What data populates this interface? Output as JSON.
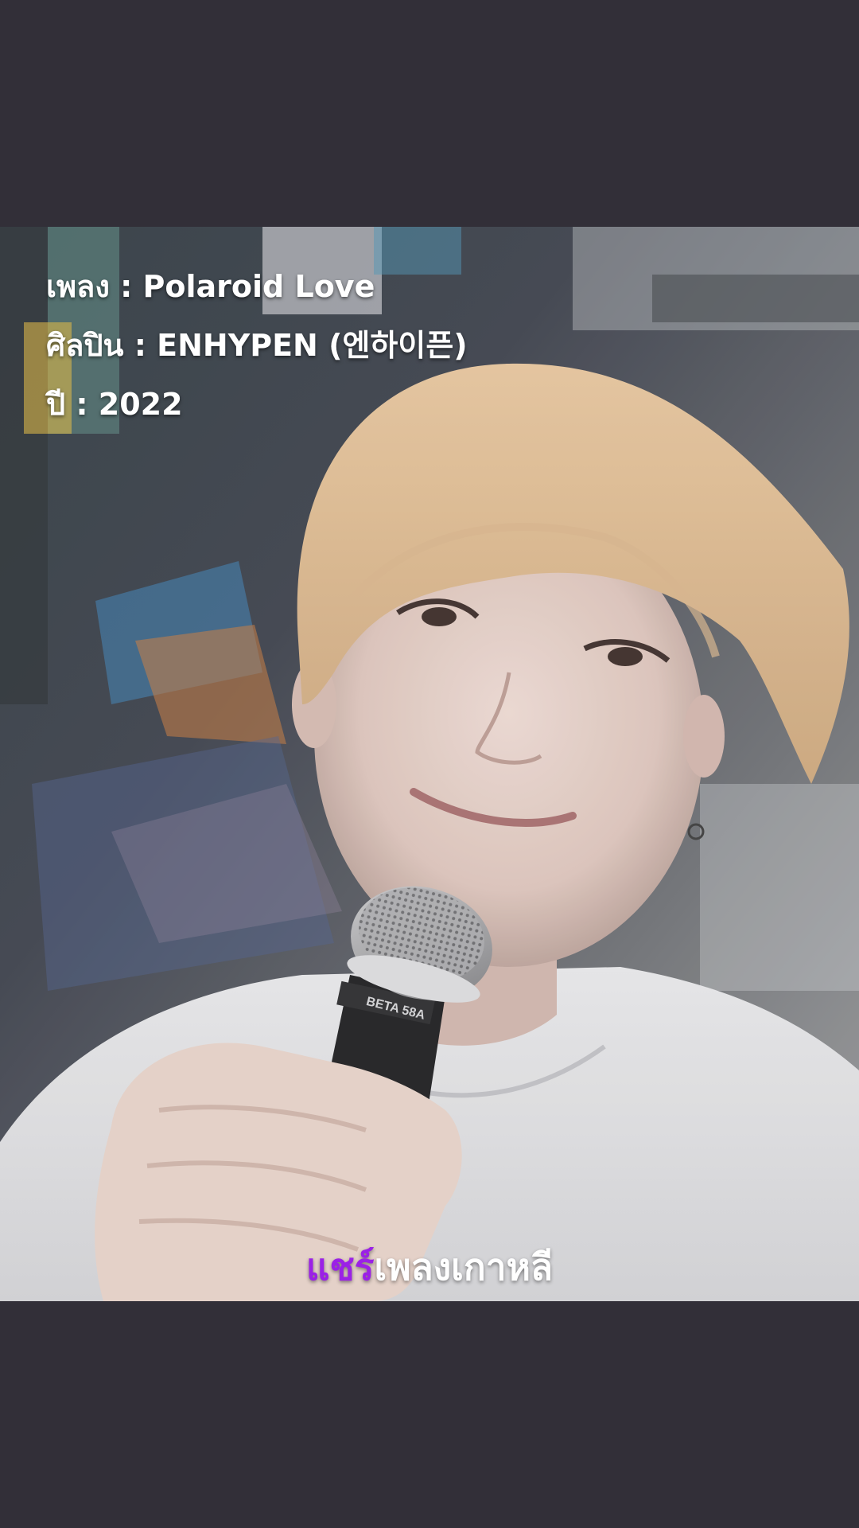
{
  "song_info": {
    "song_label": "เพลง",
    "song_value": "Polaroid Love",
    "artist_label": "ศิลปิน",
    "artist_value": "ENHYPEN (엔하이픈)",
    "year_label": "ปี",
    "year_value": "2022",
    "separator": " : "
  },
  "watermark": {
    "accent_text": "แชร์",
    "rest_text": "เพลงเกาหลี",
    "accent_color": "#9b21e6"
  },
  "microphone": {
    "brand_text": "BETA 58A"
  },
  "colors": {
    "background": "#322f38",
    "text": "#ffffff"
  }
}
